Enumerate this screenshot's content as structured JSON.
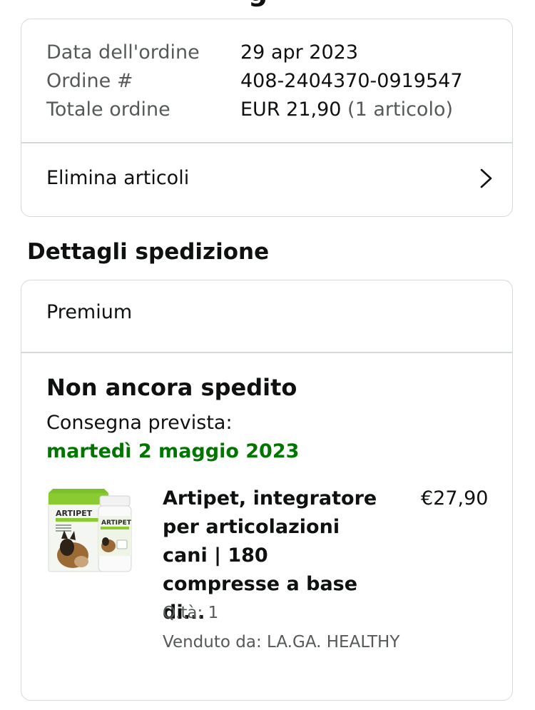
{
  "header": {
    "clipped_title_glyph": "g"
  },
  "order": {
    "rows": [
      {
        "label": "Data dell'ordine",
        "value": "29 apr 2023",
        "extra": ""
      },
      {
        "label": "Ordine #",
        "value": "408-2404370-0919547",
        "extra": ""
      },
      {
        "label": "Totale ordine",
        "value": "EUR 21,90",
        "extra": " (1 articolo)"
      }
    ],
    "delete_items_label": "Elimina articoli",
    "delete_items_icon": "chevron-right-icon"
  },
  "shipment": {
    "section_title": "Dettagli spedizione",
    "service": "Premium",
    "status": "Non ancora spedito",
    "delivery_label": "Consegna prevista:",
    "delivery_date": "martedì 2 maggio 2023",
    "delivery_date_color": "#007600",
    "product": {
      "title": "Artipet, integratore per articolazioni cani | 180 compresse a base di...",
      "price": "€27,90",
      "quantity": "Q.tà: 1",
      "seller": "Venduto da: LA.GA. HEALTHY",
      "image_brand": "ARTIPET"
    }
  }
}
